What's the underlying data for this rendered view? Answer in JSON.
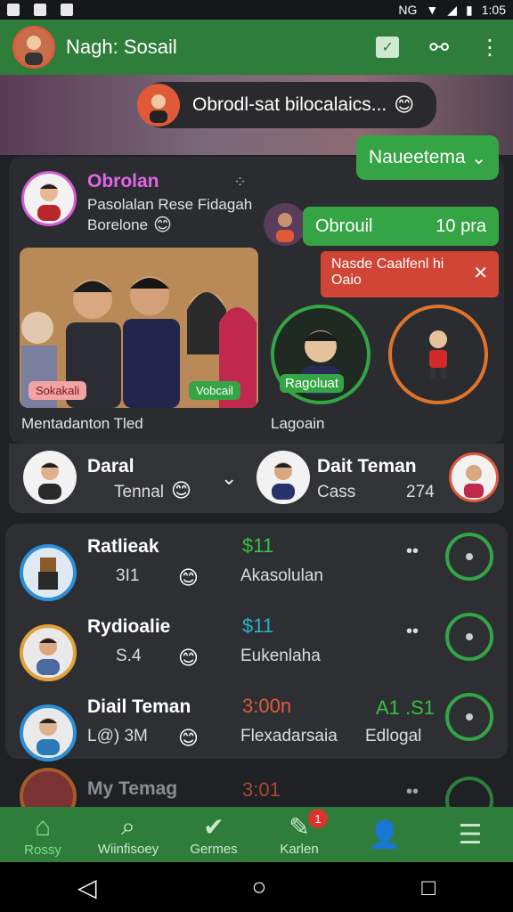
{
  "status_bar": {
    "right_text": "NG",
    "time": "1:05"
  },
  "appbar": {
    "title": "Nagh: Sosail"
  },
  "banner": {
    "text": "Obrodl-sat bilocalaics...",
    "emoji": "😊"
  },
  "green_badge": {
    "label": "Naueetema",
    "chevron": "⌄"
  },
  "main_card": {
    "title": "Obrolan",
    "subtitle_line1": "Pasolalan Rese Fidagah",
    "subtitle_line2": "Borelone",
    "subtitle_emoji": "😊",
    "photo_tag_left": "Sokakali",
    "photo_tag_right": "Vobcail",
    "photo_caption": "Mentadanton Tled",
    "right_label": "Lagoain"
  },
  "chat_chip": {
    "label": "Obrouil",
    "time": "10 pra"
  },
  "error_tip": {
    "line1": "Nasde Caalfenl hi",
    "line2": "Oaio",
    "close": "✕"
  },
  "story_label": "Ragoluat",
  "friend_cards": [
    {
      "name": "Daral",
      "sub": "Tennal",
      "emoji": "😊"
    },
    {
      "name": "Dait Teman",
      "sub": "Cass",
      "value": "274"
    }
  ],
  "list": [
    {
      "name": "Ratlieak",
      "meta": "3I1",
      "price": "$11",
      "desc": "Akasolulan",
      "extra": "",
      "price_color": "#35c045"
    },
    {
      "name": "Rydioalie",
      "meta": "S.4",
      "price": "$11",
      "desc": "Eukenlaha",
      "extra": "",
      "price_color": "#2bb0c9"
    },
    {
      "name": "Diail Teman",
      "meta": "L@) 3M",
      "price": "3:00n",
      "desc": "Flexadarsaia",
      "extra_top": "A1 .S1",
      "extra": "Edlogal",
      "price_color": "#e05a3a"
    },
    {
      "name": "My Temag",
      "meta": "",
      "price": "3:01",
      "desc": "",
      "extra": "",
      "price_color": "#e05a3a"
    }
  ],
  "bottom_nav": [
    {
      "label": "Rossy",
      "icon": "home-icon"
    },
    {
      "label": "Wiinfisoey",
      "icon": "search-icon"
    },
    {
      "label": "Germes",
      "icon": "games-icon"
    },
    {
      "label": "Karlen",
      "icon": "pen-icon",
      "badge": "1"
    },
    {
      "label": "",
      "icon": "profile-icon"
    },
    {
      "label": "",
      "icon": "menu-icon"
    }
  ],
  "colors": {
    "green": "#35a445",
    "appbar": "#2e7d3a",
    "red": "#d04535",
    "orange": "#e0732c",
    "card": "#2b2c2f"
  }
}
